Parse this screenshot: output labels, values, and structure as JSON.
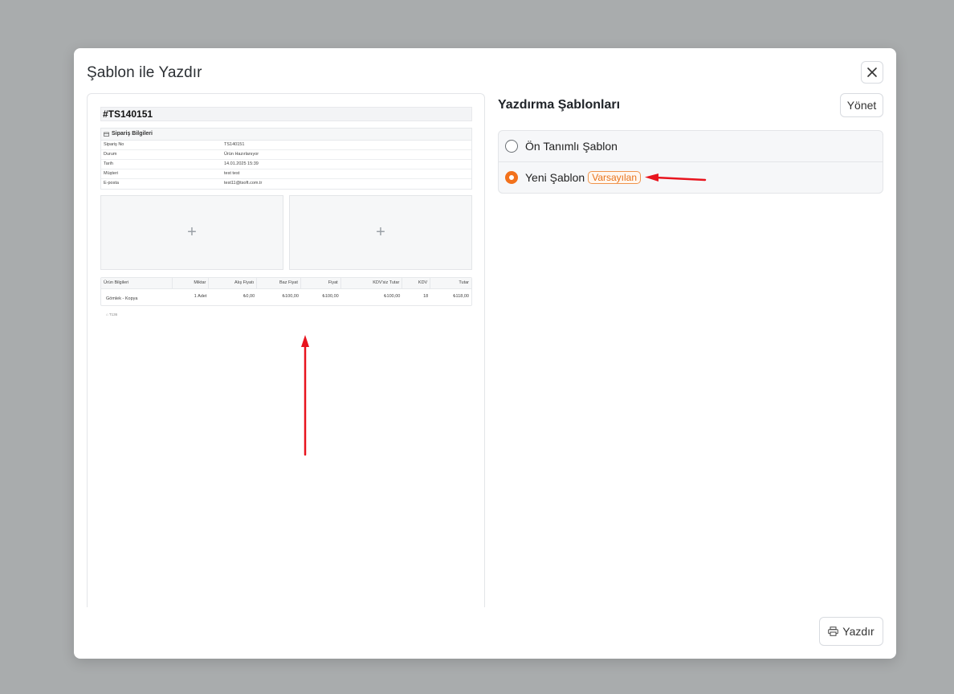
{
  "dialog": {
    "title": "Şablon ile Yazdır",
    "close_icon": "close-icon"
  },
  "preview": {
    "order_id": "#TS140151",
    "order_info": {
      "title": "Sipariş Bilgileri",
      "rows": [
        {
          "label": "Sipariş No",
          "value": "TS140151"
        },
        {
          "label": "Durum",
          "value": "Ürün Hazırlanıyor"
        },
        {
          "label": "Tarih",
          "value": "14.01.2025 15:39"
        },
        {
          "label": "Müşteri",
          "value": "test test"
        },
        {
          "label": "E-posta",
          "value": "test11@tsoft.com.tr"
        }
      ]
    },
    "image_slots": [
      "+",
      "+"
    ],
    "product_table": {
      "headers": [
        "Ürün Bilgileri",
        "Miktar",
        "Alış Fiyatı",
        "Baz Fiyat",
        "Fiyat",
        "KDV'siz Tutar",
        "KDV",
        "Tutar"
      ],
      "rows": [
        {
          "name": "Gömlek - Kopya",
          "sku": "T136",
          "cells": [
            "1 Adet",
            "₺0,00",
            "₺100,00",
            "₺100,00",
            "₺100,00",
            "18",
            "₺118,00"
          ]
        }
      ]
    }
  },
  "templates": {
    "title": "Yazdırma Şablonları",
    "manage_label": "Yönet",
    "items": [
      {
        "label": "Ön Tanımlı Şablon",
        "selected": false
      },
      {
        "label": "Yeni Şablon",
        "selected": true,
        "badge": "Varsayılan"
      }
    ]
  },
  "footer": {
    "print_label": "Yazdır",
    "print_icon": "printer-icon"
  },
  "colors": {
    "accent": "#f2711c",
    "annotation_arrow": "#e8141e"
  }
}
